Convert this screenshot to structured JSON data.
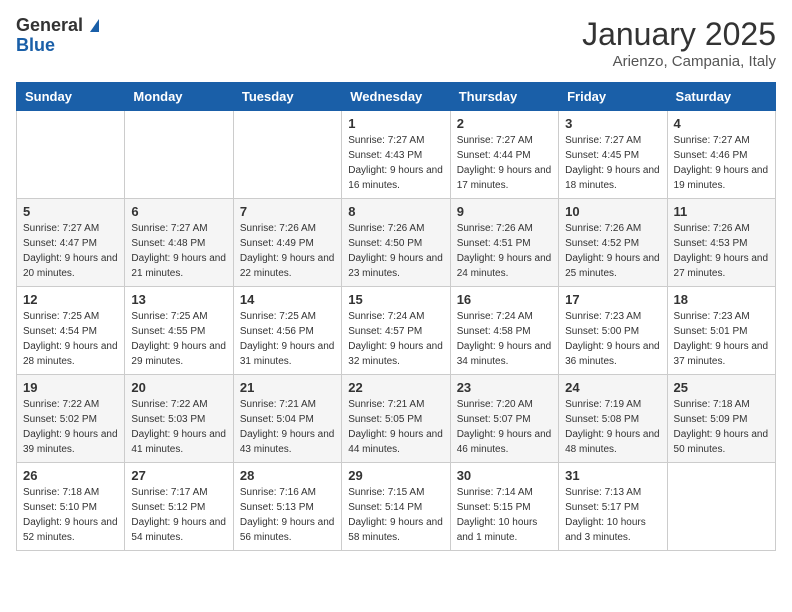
{
  "header": {
    "logo_general": "General",
    "logo_blue": "Blue",
    "month": "January 2025",
    "location": "Arienzo, Campania, Italy"
  },
  "days_of_week": [
    "Sunday",
    "Monday",
    "Tuesday",
    "Wednesday",
    "Thursday",
    "Friday",
    "Saturday"
  ],
  "weeks": [
    [
      {
        "day": "",
        "sunrise": "",
        "sunset": "",
        "daylight": ""
      },
      {
        "day": "",
        "sunrise": "",
        "sunset": "",
        "daylight": ""
      },
      {
        "day": "",
        "sunrise": "",
        "sunset": "",
        "daylight": ""
      },
      {
        "day": "1",
        "sunrise": "Sunrise: 7:27 AM",
        "sunset": "Sunset: 4:43 PM",
        "daylight": "Daylight: 9 hours and 16 minutes."
      },
      {
        "day": "2",
        "sunrise": "Sunrise: 7:27 AM",
        "sunset": "Sunset: 4:44 PM",
        "daylight": "Daylight: 9 hours and 17 minutes."
      },
      {
        "day": "3",
        "sunrise": "Sunrise: 7:27 AM",
        "sunset": "Sunset: 4:45 PM",
        "daylight": "Daylight: 9 hours and 18 minutes."
      },
      {
        "day": "4",
        "sunrise": "Sunrise: 7:27 AM",
        "sunset": "Sunset: 4:46 PM",
        "daylight": "Daylight: 9 hours and 19 minutes."
      }
    ],
    [
      {
        "day": "5",
        "sunrise": "Sunrise: 7:27 AM",
        "sunset": "Sunset: 4:47 PM",
        "daylight": "Daylight: 9 hours and 20 minutes."
      },
      {
        "day": "6",
        "sunrise": "Sunrise: 7:27 AM",
        "sunset": "Sunset: 4:48 PM",
        "daylight": "Daylight: 9 hours and 21 minutes."
      },
      {
        "day": "7",
        "sunrise": "Sunrise: 7:26 AM",
        "sunset": "Sunset: 4:49 PM",
        "daylight": "Daylight: 9 hours and 22 minutes."
      },
      {
        "day": "8",
        "sunrise": "Sunrise: 7:26 AM",
        "sunset": "Sunset: 4:50 PM",
        "daylight": "Daylight: 9 hours and 23 minutes."
      },
      {
        "day": "9",
        "sunrise": "Sunrise: 7:26 AM",
        "sunset": "Sunset: 4:51 PM",
        "daylight": "Daylight: 9 hours and 24 minutes."
      },
      {
        "day": "10",
        "sunrise": "Sunrise: 7:26 AM",
        "sunset": "Sunset: 4:52 PM",
        "daylight": "Daylight: 9 hours and 25 minutes."
      },
      {
        "day": "11",
        "sunrise": "Sunrise: 7:26 AM",
        "sunset": "Sunset: 4:53 PM",
        "daylight": "Daylight: 9 hours and 27 minutes."
      }
    ],
    [
      {
        "day": "12",
        "sunrise": "Sunrise: 7:25 AM",
        "sunset": "Sunset: 4:54 PM",
        "daylight": "Daylight: 9 hours and 28 minutes."
      },
      {
        "day": "13",
        "sunrise": "Sunrise: 7:25 AM",
        "sunset": "Sunset: 4:55 PM",
        "daylight": "Daylight: 9 hours and 29 minutes."
      },
      {
        "day": "14",
        "sunrise": "Sunrise: 7:25 AM",
        "sunset": "Sunset: 4:56 PM",
        "daylight": "Daylight: 9 hours and 31 minutes."
      },
      {
        "day": "15",
        "sunrise": "Sunrise: 7:24 AM",
        "sunset": "Sunset: 4:57 PM",
        "daylight": "Daylight: 9 hours and 32 minutes."
      },
      {
        "day": "16",
        "sunrise": "Sunrise: 7:24 AM",
        "sunset": "Sunset: 4:58 PM",
        "daylight": "Daylight: 9 hours and 34 minutes."
      },
      {
        "day": "17",
        "sunrise": "Sunrise: 7:23 AM",
        "sunset": "Sunset: 5:00 PM",
        "daylight": "Daylight: 9 hours and 36 minutes."
      },
      {
        "day": "18",
        "sunrise": "Sunrise: 7:23 AM",
        "sunset": "Sunset: 5:01 PM",
        "daylight": "Daylight: 9 hours and 37 minutes."
      }
    ],
    [
      {
        "day": "19",
        "sunrise": "Sunrise: 7:22 AM",
        "sunset": "Sunset: 5:02 PM",
        "daylight": "Daylight: 9 hours and 39 minutes."
      },
      {
        "day": "20",
        "sunrise": "Sunrise: 7:22 AM",
        "sunset": "Sunset: 5:03 PM",
        "daylight": "Daylight: 9 hours and 41 minutes."
      },
      {
        "day": "21",
        "sunrise": "Sunrise: 7:21 AM",
        "sunset": "Sunset: 5:04 PM",
        "daylight": "Daylight: 9 hours and 43 minutes."
      },
      {
        "day": "22",
        "sunrise": "Sunrise: 7:21 AM",
        "sunset": "Sunset: 5:05 PM",
        "daylight": "Daylight: 9 hours and 44 minutes."
      },
      {
        "day": "23",
        "sunrise": "Sunrise: 7:20 AM",
        "sunset": "Sunset: 5:07 PM",
        "daylight": "Daylight: 9 hours and 46 minutes."
      },
      {
        "day": "24",
        "sunrise": "Sunrise: 7:19 AM",
        "sunset": "Sunset: 5:08 PM",
        "daylight": "Daylight: 9 hours and 48 minutes."
      },
      {
        "day": "25",
        "sunrise": "Sunrise: 7:18 AM",
        "sunset": "Sunset: 5:09 PM",
        "daylight": "Daylight: 9 hours and 50 minutes."
      }
    ],
    [
      {
        "day": "26",
        "sunrise": "Sunrise: 7:18 AM",
        "sunset": "Sunset: 5:10 PM",
        "daylight": "Daylight: 9 hours and 52 minutes."
      },
      {
        "day": "27",
        "sunrise": "Sunrise: 7:17 AM",
        "sunset": "Sunset: 5:12 PM",
        "daylight": "Daylight: 9 hours and 54 minutes."
      },
      {
        "day": "28",
        "sunrise": "Sunrise: 7:16 AM",
        "sunset": "Sunset: 5:13 PM",
        "daylight": "Daylight: 9 hours and 56 minutes."
      },
      {
        "day": "29",
        "sunrise": "Sunrise: 7:15 AM",
        "sunset": "Sunset: 5:14 PM",
        "daylight": "Daylight: 9 hours and 58 minutes."
      },
      {
        "day": "30",
        "sunrise": "Sunrise: 7:14 AM",
        "sunset": "Sunset: 5:15 PM",
        "daylight": "Daylight: 10 hours and 1 minute."
      },
      {
        "day": "31",
        "sunrise": "Sunrise: 7:13 AM",
        "sunset": "Sunset: 5:17 PM",
        "daylight": "Daylight: 10 hours and 3 minutes."
      },
      {
        "day": "",
        "sunrise": "",
        "sunset": "",
        "daylight": ""
      }
    ]
  ]
}
